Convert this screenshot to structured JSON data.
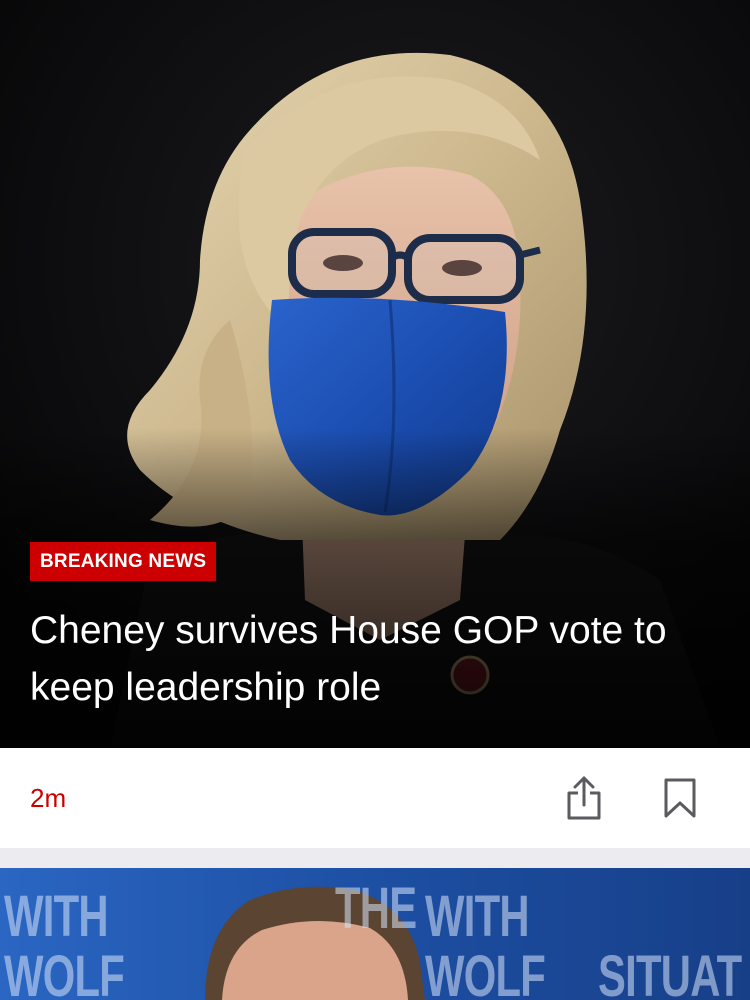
{
  "hero_story": {
    "badge_label": "BREAKING NEWS",
    "headline": "Cheney survives House GOP vote to keep leadership role",
    "image_subject": "Woman with blonde hair, glasses and a blue face mask against a dark background"
  },
  "action_bar": {
    "timestamp": "2m",
    "share_icon": "share-icon",
    "bookmark_icon": "bookmark-icon"
  },
  "next_story": {
    "image_subject": "Man in front of a blue studio backdrop",
    "backdrop_words": [
      "WITH",
      "WOLF",
      "THE",
      "WITH",
      "WOLF",
      "SITUAT"
    ]
  },
  "colors": {
    "accent_red": "#cc0000",
    "headline_text": "#ffffff",
    "icon_gray": "#5a5a5f",
    "page_background": "#ececf0"
  }
}
